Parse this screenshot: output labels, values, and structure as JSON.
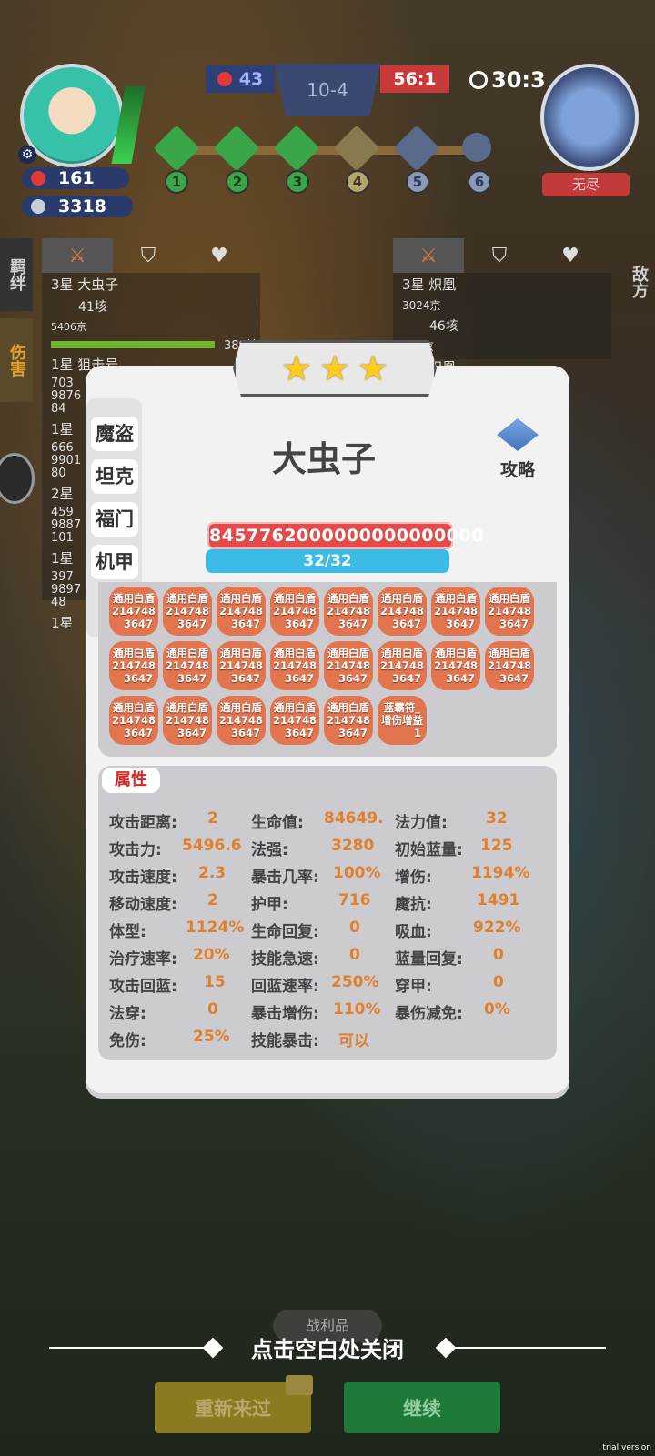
{
  "hud": {
    "hp": "161",
    "gold": "3318",
    "blue_score": "43",
    "round": "10-4",
    "red_score": "56:1",
    "timer": "30:3",
    "enemy_mode": "无尽",
    "stages": [
      "1",
      "2",
      "3",
      "4",
      "5",
      "6"
    ]
  },
  "left_tabs": {
    "bond": "羁绊",
    "damage": "伤害"
  },
  "right_tab": "敌方",
  "left_list": {
    "unit1_name": "3星 大虫子",
    "unit1_v1": "41垓",
    "unit1_v2": "5406京",
    "unit1_v3": "389垓",
    "unit2_name": "1星 狙击号",
    "unit2_nums": [
      "703",
      "9876",
      "84"
    ],
    "unit3_name": "1星",
    "unit3_nums": [
      "666",
      "9901",
      "80"
    ],
    "unit4_name": "2星",
    "unit4_nums": [
      "459",
      "9887",
      "101"
    ],
    "unit5_name": "1星",
    "unit5_nums": [
      "397",
      "9897",
      "48"
    ],
    "unit6_name": "1星"
  },
  "right_list": {
    "unit1_name": "3星 炽凰",
    "unit1_v1": "3024京",
    "unit1_v2": "46垓",
    "unit1_v3": "363京",
    "unit2_name": "3星 炽凰"
  },
  "modal": {
    "stars": [
      "★",
      "★",
      "★"
    ],
    "tags": [
      "魔盗",
      "坦克",
      "福门",
      "机甲"
    ],
    "hero_name": "大虫子",
    "guide_label": "攻略",
    "hp_value": "8457762000000000000000",
    "mana_value": "32/32",
    "items": [
      {
        "name": "通用白盾",
        "line2": "214748",
        "line3": "3647"
      },
      {
        "name": "通用白盾",
        "line2": "214748",
        "line3": "3647"
      },
      {
        "name": "通用白盾",
        "line2": "214748",
        "line3": "3647"
      },
      {
        "name": "通用白盾",
        "line2": "214748",
        "line3": "3647"
      },
      {
        "name": "通用白盾",
        "line2": "214748",
        "line3": "3647"
      },
      {
        "name": "通用白盾",
        "line2": "214748",
        "line3": "3647"
      },
      {
        "name": "通用白盾",
        "line2": "214748",
        "line3": "3647"
      },
      {
        "name": "通用白盾",
        "line2": "214748",
        "line3": "3647"
      },
      {
        "name": "通用白盾",
        "line2": "214748",
        "line3": "3647"
      },
      {
        "name": "通用白盾",
        "line2": "214748",
        "line3": "3647"
      },
      {
        "name": "通用白盾",
        "line2": "214748",
        "line3": "3647"
      },
      {
        "name": "通用白盾",
        "line2": "214748",
        "line3": "3647"
      },
      {
        "name": "通用白盾",
        "line2": "214748",
        "line3": "3647"
      },
      {
        "name": "通用白盾",
        "line2": "214748",
        "line3": "3647"
      },
      {
        "name": "通用白盾",
        "line2": "214748",
        "line3": "3647"
      },
      {
        "name": "通用白盾",
        "line2": "214748",
        "line3": "3647"
      },
      {
        "name": "通用白盾",
        "line2": "214748",
        "line3": "3647"
      },
      {
        "name": "通用白盾",
        "line2": "214748",
        "line3": "3647"
      },
      {
        "name": "通用白盾",
        "line2": "214748",
        "line3": "3647"
      },
      {
        "name": "通用白盾",
        "line2": "214748",
        "line3": "3647"
      },
      {
        "name": "通用白盾",
        "line2": "214748",
        "line3": "3647"
      },
      {
        "name": "蓝霸符_",
        "line2": "增伤增益",
        "line3": "1"
      }
    ],
    "attr_title": "属性",
    "attrs": [
      {
        "label": "攻击距离:",
        "value": "2"
      },
      {
        "label": "生命值:",
        "value": "84649."
      },
      {
        "label": "法力值:",
        "value": "32"
      },
      {
        "label": "攻击力:",
        "value": "5496.6"
      },
      {
        "label": "法强:",
        "value": "3280"
      },
      {
        "label": "初始蓝量:",
        "value": "125"
      },
      {
        "label": "攻击速度:",
        "value": "2.3"
      },
      {
        "label": "暴击几率:",
        "value": "100%"
      },
      {
        "label": "增伤:",
        "value": "1194%"
      },
      {
        "label": "移动速度:",
        "value": "2"
      },
      {
        "label": "护甲:",
        "value": "716"
      },
      {
        "label": "魔抗:",
        "value": "1491"
      },
      {
        "label": "体型:",
        "value": "1124%"
      },
      {
        "label": "生命回复:",
        "value": "0"
      },
      {
        "label": "吸血:",
        "value": "922%"
      },
      {
        "label": "治疗速率:",
        "value": "20%"
      },
      {
        "label": "技能急速:",
        "value": "0"
      },
      {
        "label": "蓝量回复:",
        "value": "0"
      },
      {
        "label": "攻击回蓝:",
        "value": "15"
      },
      {
        "label": "回蓝速率:",
        "value": "250%"
      },
      {
        "label": "穿甲:",
        "value": "0"
      },
      {
        "label": "法穿:",
        "value": "0"
      },
      {
        "label": "暴击增伤:",
        "value": "110%"
      },
      {
        "label": "暴伤减免:",
        "value": "0%"
      },
      {
        "label": "免伤:",
        "value": "25%"
      },
      {
        "label": "技能暴击:",
        "value": "可以"
      }
    ]
  },
  "footer": {
    "close_hint": "点击空白处关闭",
    "spoils": "战利品",
    "retry": "重新来过",
    "continue": "继续",
    "trial": "trial version"
  }
}
